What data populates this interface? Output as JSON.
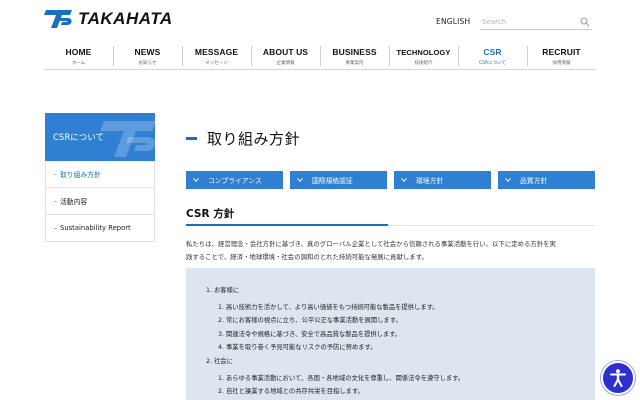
{
  "header": {
    "brand": "TAKAHATA",
    "language_link": "ENGLISH",
    "search_placeholder": "Search"
  },
  "nav": [
    {
      "en": "HOME",
      "jp": "ホーム"
    },
    {
      "en": "NEWS",
      "jp": "お知らせ"
    },
    {
      "en": "MESSAGE",
      "jp": "メッセージ"
    },
    {
      "en": "ABOUT US",
      "jp": "企業情報"
    },
    {
      "en": "BUSINESS",
      "jp": "事業案内"
    },
    {
      "en": "TECHNOLOGY",
      "jp": "技術紹介"
    },
    {
      "en": "CSR",
      "jp": "CSRについて"
    },
    {
      "en": "RECRUIT",
      "jp": "採用情報"
    }
  ],
  "sidebar": {
    "title": "CSRについて",
    "items": [
      {
        "label": "取り組み方針"
      },
      {
        "label": "活動内容"
      },
      {
        "label": "Sustainability Report"
      }
    ]
  },
  "main": {
    "page_title": "取り組み方針",
    "tabs": [
      {
        "label": "コンプライアンス"
      },
      {
        "label": "国際規格認証"
      },
      {
        "label": "環境方針"
      },
      {
        "label": "品質方針"
      }
    ],
    "section_title": "CSR 方針",
    "intro_line1": "私たちは、経営理念・会社方針に基づき、真のグローバル企業として社会から信頼される事業活動を行い、以下に定める方針を実",
    "intro_line2": "践することで、経済・地球環境・社会の調和のとれた持続可能な発展に貢献します。",
    "policy": [
      {
        "heading": "1. お客様に",
        "items": [
          "1. 高い技術力を活かして、より高い価値をもつ持続可能な製品を提供します。",
          "2. 常にお客様の視点に立ち、公平公正な事業活動を展開します。",
          "3. 関連法令や規格に基づき、安全で高品質な製品を提供します。",
          "4. 事業を取り巻く予見可能なリスクの予防に努めます。"
        ]
      },
      {
        "heading": "2. 社会に",
        "items": [
          "1. あらゆる事業活動において、各国・各地域の文化を尊重し、関係法令を遵守します。",
          "2. 自社と操業する地域との共存共栄を目指します。"
        ]
      }
    ]
  },
  "colors": {
    "brand_blue": "#2f7fd3",
    "accent_blue": "#1a6fc0",
    "policy_bg": "#dde6f0",
    "fab": "#2f2fd0"
  },
  "icons": {
    "search": "search-icon",
    "accessibility": "accessibility-icon",
    "tab_chevron": "chevron-down-icon"
  }
}
